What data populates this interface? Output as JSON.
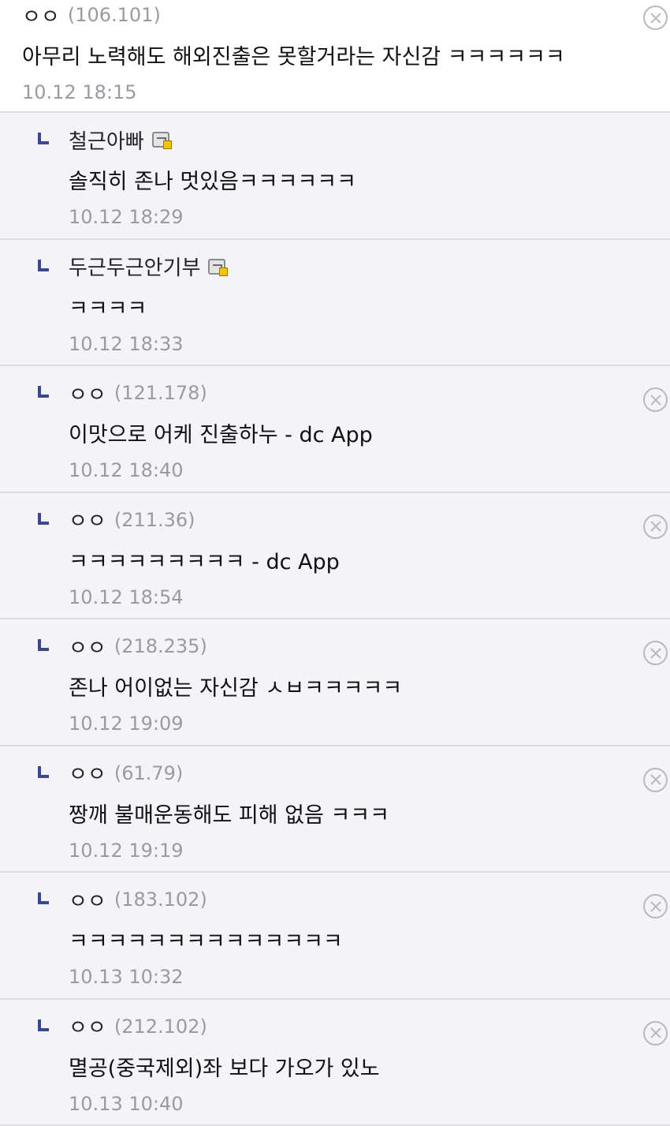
{
  "comments": [
    {
      "nick": "ㅇㅇ",
      "ip": "(106.101)",
      "text": "아무리 노력해도 해외진출은 못할거라는 자신감 ㅋㅋㅋㅋㅋㅋ",
      "time": "10.12 18:15"
    },
    {
      "nick": "철근아빠",
      "text": "솔직히 존나 멋있음ㅋㅋㅋㅋㅋㅋ",
      "time": "10.12 18:29"
    },
    {
      "nick": "두근두근안기부",
      "text": "ㅋㅋㅋㅋ",
      "time": "10.12 18:33"
    },
    {
      "nick": "ㅇㅇ",
      "ip": "(121.178)",
      "text": "이맛으로 어케 진출하누 - dc App",
      "time": "10.12 18:40"
    },
    {
      "nick": "ㅇㅇ",
      "ip": "(211.36)",
      "text": "ㅋㅋㅋㅋㅋㅋㅋㅋㅋ - dc App",
      "time": "10.12 18:54"
    },
    {
      "nick": "ㅇㅇ",
      "ip": "(218.235)",
      "text": "존나 어이없는 자신감 ㅅㅂㅋㅋㅋㅋㅋ",
      "time": "10.12 19:09"
    },
    {
      "nick": "ㅇㅇ",
      "ip": "(61.79)",
      "text": "짱깨 불매운동해도 피해 없음 ㅋㅋㅋ",
      "time": "10.12 19:19"
    },
    {
      "nick": "ㅇㅇ",
      "ip": "(183.102)",
      "text": "ㅋㅋㅋㅋㅋㅋㅋㅋㅋㅋㅋㅋㅋㅋ",
      "time": "10.13 10:32"
    },
    {
      "nick": "ㅇㅇ",
      "ip": "(212.102)",
      "text": "멸공(중국제외)좌 보다 가오가 있노",
      "time": "10.13 10:40"
    }
  ]
}
